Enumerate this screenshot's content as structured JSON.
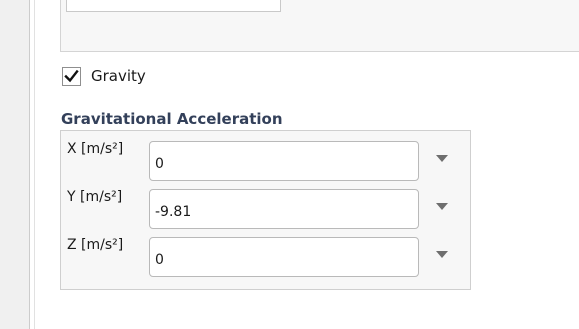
{
  "gravity": {
    "label": "Gravity",
    "checked": true
  },
  "section": {
    "title": "Gravitational Acceleration"
  },
  "fields": [
    {
      "axis": "X",
      "unit": "[m/s²]",
      "value": "0",
      "dropdown_icon": "caret-down-icon"
    },
    {
      "axis": "Y",
      "unit": "[m/s²]",
      "value": "-9.81",
      "dropdown_icon": "caret-down-icon"
    },
    {
      "axis": "Z",
      "unit": "[m/s²]",
      "value": "0",
      "dropdown_icon": "caret-down-icon"
    }
  ],
  "labels": {
    "x": "X [m/s²]",
    "y": "Y [m/s²]",
    "z": "Z [m/s²]"
  },
  "colors": {
    "section_title": "#33405a",
    "group_bg": "#f7f7f7",
    "border": "#cfcfcf"
  }
}
